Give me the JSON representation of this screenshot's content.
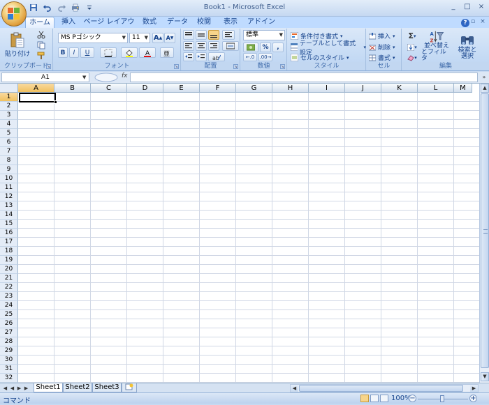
{
  "window": {
    "title": "Book1 - Microsoft Excel",
    "controls": [
      "_",
      "□",
      "×"
    ]
  },
  "quick_access": [
    "save-icon",
    "undo-icon",
    "redo-icon",
    "print-icon",
    "customize-icon"
  ],
  "tabs": [
    {
      "label": "ホーム",
      "active": true
    },
    {
      "label": "挿入"
    },
    {
      "label": "ページ レイアウト"
    },
    {
      "label": "数式"
    },
    {
      "label": "データ"
    },
    {
      "label": "校閲"
    },
    {
      "label": "表示"
    },
    {
      "label": "アドイン"
    }
  ],
  "ribbon": {
    "clipboard": {
      "paste_label": "貼り付け",
      "group_label": "クリップボード"
    },
    "font": {
      "font_name": "MS Pゴシック",
      "font_size": "11",
      "bold": "B",
      "italic": "I",
      "underline": "U",
      "grow": "A",
      "shrink": "A",
      "group_label": "フォント"
    },
    "alignment": {
      "group_label": "配置"
    },
    "number": {
      "format": "標準",
      "percent": "%",
      "comma": ",",
      "group_label": "数値"
    },
    "styles": {
      "conditional": "条件付き書式",
      "table": "テーブルとして書式設定",
      "cell_styles": "セルのスタイル",
      "group_label": "スタイル"
    },
    "cells": {
      "insert": "挿入",
      "delete": "削除",
      "format": "書式",
      "group_label": "セル"
    },
    "editing": {
      "sort": "並べ替え",
      "sort_line2": "とフィルタ",
      "find": "検索と",
      "find_line2": "選択",
      "group_label": "編集"
    }
  },
  "formula_bar": {
    "name_box": "A1",
    "fx": "fx",
    "value": ""
  },
  "columns": [
    "A",
    "B",
    "C",
    "D",
    "E",
    "F",
    "G",
    "H",
    "I",
    "J",
    "K",
    "L",
    "M"
  ],
  "rows": [
    "1",
    "2",
    "3",
    "4",
    "5",
    "6",
    "7",
    "8",
    "9",
    "10",
    "11",
    "12",
    "13",
    "14",
    "15",
    "16",
    "17",
    "18",
    "19",
    "20",
    "21",
    "22",
    "23",
    "24",
    "25",
    "26",
    "27",
    "28",
    "29",
    "30",
    "31",
    "32"
  ],
  "selected_cell": "A1",
  "sheets": [
    "Sheet1",
    "Sheet2",
    "Sheet3"
  ],
  "active_sheet": "Sheet1",
  "status": {
    "mode": "コマンド",
    "zoom": "100%"
  }
}
